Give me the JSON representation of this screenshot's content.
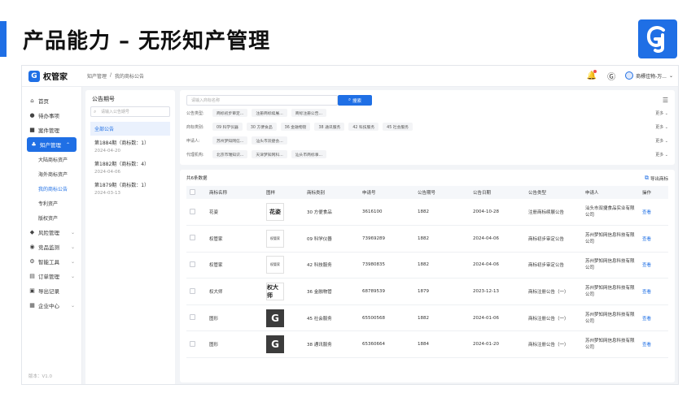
{
  "slide": {
    "title": "产品能力 – 无形知产管理"
  },
  "app": {
    "name": "权管家",
    "breadcrumb": [
      "知产管理",
      "/",
      "我的商标公告"
    ],
    "user": "商標佳物-万..."
  },
  "sidebar": {
    "items": [
      {
        "label": "首页",
        "icon": "home-icon"
      },
      {
        "label": "待办事项",
        "icon": "todo-icon"
      },
      {
        "label": "案件管理",
        "icon": "folder-icon"
      },
      {
        "label": "知产管理",
        "icon": "ip-icon",
        "active": true
      },
      {
        "label": "风险管理",
        "icon": "shield-icon"
      },
      {
        "label": "竞品监测",
        "icon": "monitor-icon"
      },
      {
        "label": "智能工具",
        "icon": "tools-icon"
      },
      {
        "label": "订单管理",
        "icon": "order-icon"
      },
      {
        "label": "导出记录",
        "icon": "export-icon"
      },
      {
        "label": "企业中心",
        "icon": "company-icon"
      }
    ],
    "subitems": [
      "大陆商标资产",
      "海外商标资产",
      "我的商标公告",
      "专利资产",
      "版权资产"
    ],
    "version": "版本：V1.0"
  },
  "announcements": {
    "title": "公告期号",
    "search_placeholder": "请输入公告期号",
    "items": [
      {
        "title": "全部公告",
        "date": ""
      },
      {
        "title": "第1884期（商标数：1）",
        "date": "2024-04-20"
      },
      {
        "title": "第1882期（商标数：4）",
        "date": "2024-04-06"
      },
      {
        "title": "第1879期（商标数：1）",
        "date": "2024-03-13"
      }
    ]
  },
  "filters": {
    "search_placeholder": "请输入商标名称",
    "search_button": "搜索",
    "more": "更多 ⌄",
    "rows": [
      {
        "label": "公告类型:",
        "chips": [
          "商标初步审定...",
          "注册商标续展...",
          "商标注册公告..."
        ]
      },
      {
        "label": "商标类别:",
        "chips": [
          "09 科学仪器",
          "30 方便食品",
          "36 金融物管",
          "38 通讯服务",
          "42 科技服务",
          "45 社会服务"
        ]
      },
      {
        "label": "申请人:",
        "chips": [
          "苏州梦知网信...",
          "汕头市双捷会..."
        ]
      },
      {
        "label": "代理机构:",
        "chips": [
          "北京市瑞知识...",
          "天津梦知网科...",
          "汕头市商标事..."
        ]
      }
    ]
  },
  "table": {
    "count_label": "共6条数据",
    "export_label": "导出商标",
    "headers": [
      "",
      "商标名称",
      "图样",
      "商标类别",
      "申请号",
      "公告期号",
      "公告日期",
      "公告类型",
      "申请人",
      "操作"
    ],
    "rows": [
      {
        "name": "花姿",
        "img": "花姿",
        "img_style": "brush",
        "category": "30 方便食品",
        "app_no": "3616100",
        "issue": "1882",
        "date": "2004-10-28",
        "type": "注册商标续展公告",
        "applicant": "汕头市双捷食品实业有限公司",
        "action": "查看"
      },
      {
        "name": "权管家",
        "img": "权管家",
        "img_style": "plain",
        "category": "09 科学仪器",
        "app_no": "73969289",
        "issue": "1882",
        "date": "2024-04-06",
        "type": "商标初步审定公告",
        "applicant": "苏州梦知网信息科技有限公司",
        "action": "查看"
      },
      {
        "name": "权管家",
        "img": "权管家",
        "img_style": "plain",
        "category": "42 科技服务",
        "app_no": "73980835",
        "issue": "1882",
        "date": "2024-04-06",
        "type": "商标初步审定公告",
        "applicant": "苏州梦知网信息科技有限公司",
        "action": "查看"
      },
      {
        "name": "权大师",
        "img": "权大师",
        "img_style": "brush",
        "category": "36 金融物管",
        "app_no": "68789539",
        "issue": "1879",
        "date": "2023-12-13",
        "type": "商标注册公告（一）",
        "applicant": "苏州梦知网信息科技有限公司",
        "action": "查看"
      },
      {
        "name": "图形",
        "img": "G",
        "img_style": "dark",
        "category": "45 社会服务",
        "app_no": "65500568",
        "issue": "1882",
        "date": "2024-01-06",
        "type": "商标注册公告（一）",
        "applicant": "苏州梦知网信息科技有限公司",
        "action": "查看"
      },
      {
        "name": "图形",
        "img": "G",
        "img_style": "dark",
        "category": "38 通讯服务",
        "app_no": "65360664",
        "issue": "1884",
        "date": "2024-01-20",
        "type": "商标注册公告（一）",
        "applicant": "苏州梦知网信息科技有限公司",
        "action": "查看"
      }
    ]
  },
  "colors": {
    "accent": "#1f6fe5"
  }
}
